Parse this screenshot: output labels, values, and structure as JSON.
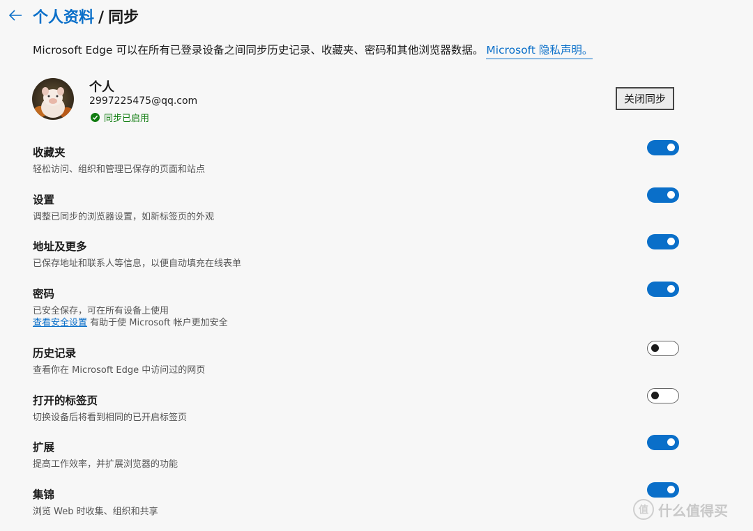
{
  "header": {
    "crumb": "个人资料",
    "separator": "/",
    "current": "同步"
  },
  "intro": {
    "text": "Microsoft Edge 可以在所有已登录设备之间同步历史记录、收藏夹、密码和其他浏览器数据。",
    "link": "Microsoft 隐私声明。"
  },
  "profile": {
    "name": "个人",
    "email": "2997225475@qq.com",
    "status": "同步已启用",
    "turn_off_label": "关闭同步"
  },
  "sync_items": [
    {
      "name": "收藏夹",
      "desc": "轻松访问、组织和管理已保存的页面和站点",
      "enabled": true
    },
    {
      "name": "设置",
      "desc": "调整已同步的浏览器设置，如新标签页的外观",
      "enabled": true
    },
    {
      "name": "地址及更多",
      "desc": "已保存地址和联系人等信息，以便自动填充在线表单",
      "enabled": true
    },
    {
      "name": "密码",
      "desc": "已安全保存，可在所有设备上使用",
      "link": "查看安全设置",
      "desc2": " 有助于使 Microsoft 帐户更加安全",
      "enabled": true
    },
    {
      "name": "历史记录",
      "desc": "查看你在 Microsoft Edge 中访问过的网页",
      "enabled": false
    },
    {
      "name": "打开的标签页",
      "desc": "切换设备后将看到相同的已开启标签页",
      "enabled": false
    },
    {
      "name": "扩展",
      "desc": "提高工作效率，并扩展浏览器的功能",
      "enabled": true
    },
    {
      "name": "集锦",
      "desc": "浏览 Web 时收集、组织和共享",
      "enabled": true
    }
  ],
  "watermark": {
    "logo": "值",
    "text": "什么值得买"
  },
  "colors": {
    "accent": "#0a6fc9",
    "success": "#107c10",
    "background": "#f7f7f7"
  },
  "icons": {
    "back": "arrow-left-icon",
    "status": "checkmark-circle-icon"
  }
}
